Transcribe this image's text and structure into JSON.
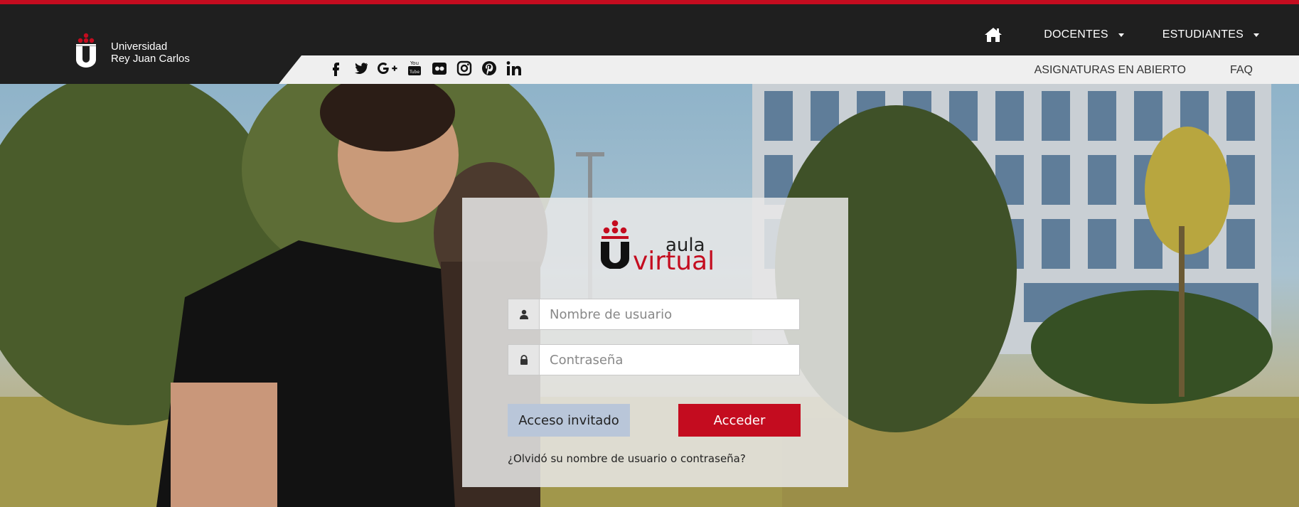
{
  "header": {
    "university_line1": "Universidad",
    "university_line2": "Rey Juan Carlos",
    "nav": {
      "docentes": "DOCENTES",
      "estudiantes": "ESTUDIANTES"
    },
    "sublinks": {
      "asignaturas": "ASIGNATURAS EN ABIERTO",
      "faq": "FAQ"
    },
    "social": [
      "facebook-icon",
      "twitter-icon",
      "google-plus-icon",
      "youtube-icon",
      "flickr-icon",
      "instagram-icon",
      "pinterest-icon",
      "linkedin-icon"
    ]
  },
  "login": {
    "logo_word1": "aula",
    "logo_word2": "virtual",
    "username_placeholder": "Nombre de usuario",
    "password_placeholder": "Contraseña",
    "guest_button": "Acceso invitado",
    "login_button": "Acceder",
    "forgot_link": "¿Olvidó su nombre de usuario o contraseña?"
  },
  "colors": {
    "brand_red": "#c40c1f",
    "header_bg": "#1f1f1f",
    "guest_btn": "#b9c6d9"
  }
}
